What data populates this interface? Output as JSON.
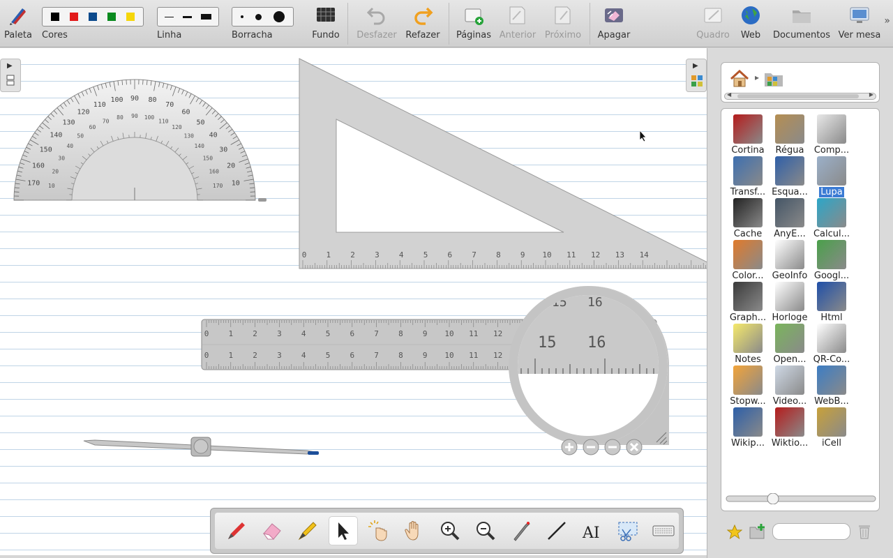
{
  "toolbar": {
    "palette_label": "Paleta",
    "colors_label": "Cores",
    "colors": [
      "#000000",
      "#e21a1a",
      "#0c4a8c",
      "#0a8a1f",
      "#f5d60a"
    ],
    "line_label": "Linha",
    "eraser_label": "Borracha",
    "background_label": "Fundo",
    "undo_label": "Desfazer",
    "redo_label": "Refazer",
    "pages_label": "Páginas",
    "previous_label": "Anterior",
    "next_label": "Próximo",
    "erase_label": "Apagar",
    "board_label": "Quadro",
    "web_label": "Web",
    "documents_label": "Documentos",
    "desktop_label": "Ver mesa",
    "more": "»"
  },
  "board": {
    "protractor": {
      "outer_labels": [
        "170",
        "160",
        "150",
        "140",
        "130",
        "120",
        "110",
        "100",
        "90",
        "80",
        "70",
        "60",
        "50",
        "40",
        "30",
        "20",
        "10"
      ],
      "inner_labels": [
        "10",
        "20",
        "30",
        "40",
        "50",
        "60",
        "70",
        "80",
        "90",
        "100",
        "110",
        "120",
        "130",
        "140",
        "150",
        "160",
        "170"
      ]
    },
    "set_square": {
      "ticks": [
        "0",
        "1",
        "2",
        "3",
        "4",
        "5",
        "6",
        "7",
        "8",
        "9",
        "10",
        "11",
        "12",
        "13",
        "14"
      ]
    },
    "ruler": {
      "ticks": [
        "0",
        "1",
        "2",
        "3",
        "4",
        "5",
        "6",
        "7",
        "8",
        "9",
        "10",
        "11",
        "12"
      ]
    },
    "magnifier": {
      "top_labels": [
        "15",
        "16"
      ],
      "big_labels": [
        "15",
        "16"
      ]
    }
  },
  "panel": {
    "home_icon": "home-icon",
    "folder_icon": "apps-folder-icon",
    "path_sep": "▸",
    "items": [
      {
        "label": "Cortina",
        "icon": "curtain-icon",
        "color": "#b51c1c"
      },
      {
        "label": "Régua",
        "icon": "ruler-icon",
        "color": "#b58e52"
      },
      {
        "label": "Comp...",
        "icon": "compass-icon",
        "color": "#e8e8e8"
      },
      {
        "label": "Transf...",
        "icon": "protractor-icon",
        "color": "#3d6fb0"
      },
      {
        "label": "Esqua...",
        "icon": "set-square-icon",
        "color": "#2f5fa8"
      },
      {
        "label": "Lupa",
        "icon": "magnifier-icon",
        "color": "#9bb0c9"
      },
      {
        "label": "Cache",
        "icon": "cache-icon",
        "color": "#222222"
      },
      {
        "label": "AnyE...",
        "icon": "any-embed-icon",
        "color": "#445566"
      },
      {
        "label": "Calcul...",
        "icon": "calculator-icon",
        "color": "#2ca6c8"
      },
      {
        "label": "Color...",
        "icon": "color-picker-icon",
        "color": "#e07a2b"
      },
      {
        "label": "GeoInfo",
        "icon": "world-map-icon",
        "color": "#ffffff"
      },
      {
        "label": "Googl...",
        "icon": "google-maps-icon",
        "color": "#4aa04a"
      },
      {
        "label": "Graph...",
        "icon": "graph-icon",
        "color": "#3a3a3a"
      },
      {
        "label": "Horloge",
        "icon": "clock-icon",
        "color": "#ffffff"
      },
      {
        "label": "Html",
        "icon": "html-icon",
        "color": "#1f4fa8"
      },
      {
        "label": "Notes",
        "icon": "notes-icon",
        "color": "#f5e96b"
      },
      {
        "label": "Open...",
        "icon": "open-search-icon",
        "color": "#7ab55c"
      },
      {
        "label": "QR-Co...",
        "icon": "qr-code-icon",
        "color": "#ffffff"
      },
      {
        "label": "Stopw...",
        "icon": "stopwatch-icon",
        "color": "#f2a43a"
      },
      {
        "label": "Video...",
        "icon": "video-icon",
        "color": "#cfd9e6"
      },
      {
        "label": "WebB...",
        "icon": "web-browser-icon",
        "color": "#3c7dc4"
      },
      {
        "label": "Wikip...",
        "icon": "wikipedia-icon",
        "color": "#2d5fa8"
      },
      {
        "label": "Wiktio...",
        "icon": "wiktionary-icon",
        "color": "#b51c1c"
      },
      {
        "label": "iCell",
        "icon": "icell-icon",
        "color": "#c8a13a"
      }
    ],
    "selected_index": 5,
    "zoom_value": 0.3,
    "search_value": ""
  },
  "stylus": {
    "tools": [
      "pen",
      "eraser",
      "marker",
      "selector",
      "interact",
      "hand",
      "zoom-in",
      "zoom-out",
      "laser",
      "line",
      "text",
      "capture",
      "keyboard"
    ],
    "active": "selector",
    "text_tool_label": "AI"
  }
}
